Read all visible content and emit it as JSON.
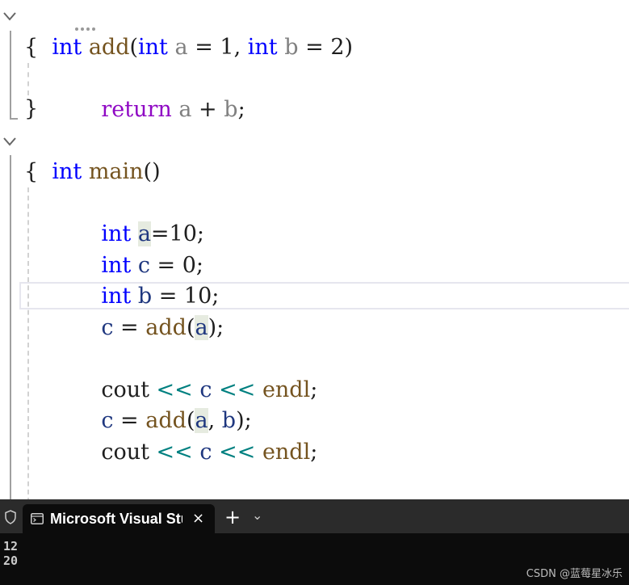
{
  "code": {
    "l1": {
      "kw1": "int",
      "fn": "add",
      "open": "(",
      "kw2": "int",
      "p1": "a",
      "eq1": " = ",
      "v1": "1",
      "comma": ", ",
      "kw3": "int",
      "p2": "b",
      "eq2": " = ",
      "v2": "2",
      "close": ")"
    },
    "l2": "{",
    "l3": {
      "kw": "return",
      "a": "a",
      "op": " + ",
      "b": "b",
      "end": ";"
    },
    "l4": "}",
    "l5": {
      "kw": "int",
      "fn": "main",
      "paren": "()"
    },
    "l6": "{",
    "l7": {
      "kw": "int",
      "var": "a",
      "rest": "=10;"
    },
    "l8": {
      "kw": "int",
      "var": "c",
      "rest": " = 0;"
    },
    "l9": {
      "kw": "int",
      "var": "b",
      "rest": " = 10;"
    },
    "l10": {
      "var": "c",
      "eq": " = ",
      "fn": "add",
      "open": "(",
      "arg": "a",
      "close": ");"
    },
    "l12": {
      "obj": "cout",
      "op1": " << ",
      "var": "c",
      "op2": " << ",
      "end": "endl",
      "semi": ";"
    },
    "l13": {
      "var": "c",
      "eq": " = ",
      "fn": "add",
      "open": "(",
      "arg1": "a",
      "comma": ", ",
      "arg2": "b",
      "close": ");"
    },
    "l14": {
      "obj": "cout",
      "op1": " << ",
      "var": "c",
      "op2": " << ",
      "end": "endl",
      "semi": ";"
    }
  },
  "terminal": {
    "tab_title": "Microsoft Visual Studio 调试控制台",
    "close_symbol": "×",
    "new_tab_symbol": "+",
    "dropdown_symbol": "⌄",
    "output": [
      "12",
      "20"
    ]
  },
  "watermark": "CSDN @蓝莓星冰乐",
  "colors": {
    "keyword": "#0000ff",
    "return_keyword": "#8f08c4",
    "function": "#74531f",
    "parameter": "#808080",
    "local_variable": "#1f377f",
    "operator": "#008080",
    "terminal_bg": "#0c0c0c"
  }
}
